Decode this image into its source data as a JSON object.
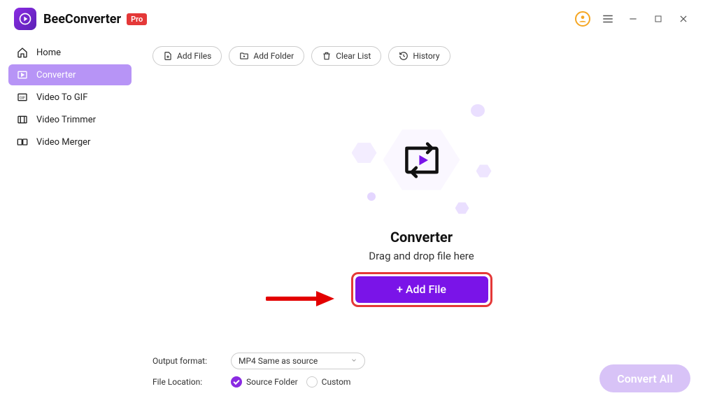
{
  "header": {
    "app_name": "BeeConverter",
    "pro_label": "Pro"
  },
  "sidebar": {
    "items": [
      {
        "label": "Home"
      },
      {
        "label": "Converter"
      },
      {
        "label": "Video To GIF"
      },
      {
        "label": "Video Trimmer"
      },
      {
        "label": "Video Merger"
      }
    ]
  },
  "toolbar": {
    "add_files": "Add Files",
    "add_folder": "Add Folder",
    "clear_list": "Clear List",
    "history": "History"
  },
  "dropzone": {
    "title": "Converter",
    "subtitle": "Drag and drop file here",
    "add_button": "+ Add File"
  },
  "bottom": {
    "output_format_label": "Output format:",
    "output_format_value": "MP4 Same as source",
    "file_location_label": "File Location:",
    "source_folder_label": "Source Folder",
    "custom_label": "Custom"
  },
  "convert_all": "Convert All"
}
